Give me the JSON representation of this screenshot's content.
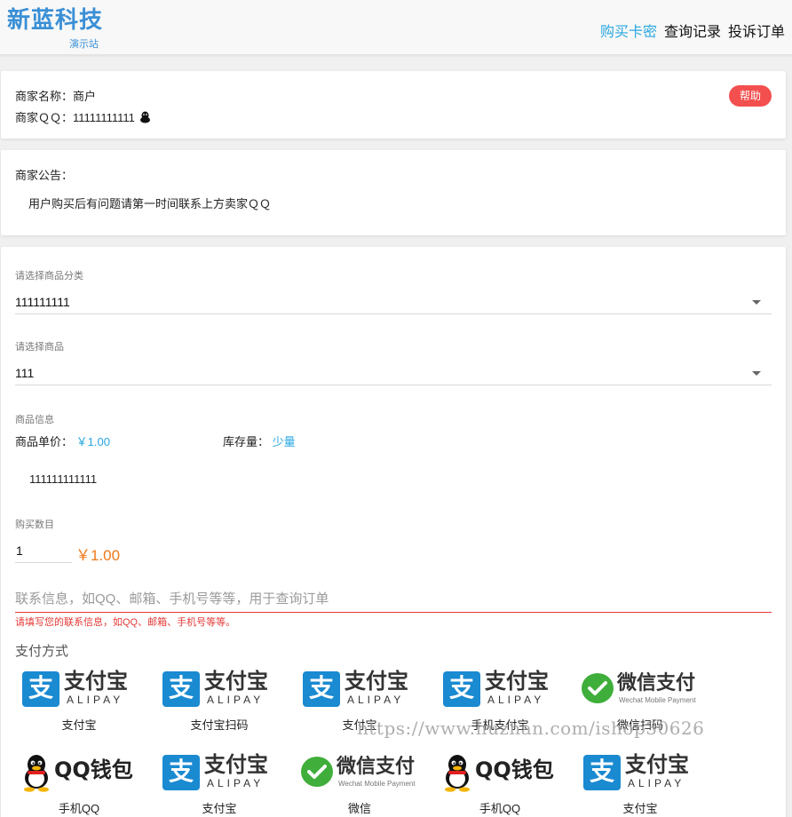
{
  "header": {
    "logo_text": "新蓝科技",
    "logo_sub": "演示站",
    "nav": [
      "购买卡密",
      "查询记录",
      "投诉订单"
    ],
    "accent_color": "#2aa7e0"
  },
  "merchant": {
    "name_label": "商家名称：",
    "name_value": "商户",
    "qq_label": "商家ＱＱ：",
    "qq_value": "11111111111",
    "help_label": "帮助",
    "help_color": "#f44f4f"
  },
  "notice": {
    "title": "商家公告：",
    "body": "用户购买后有问题请第一时间联系上方卖家ＱＱ"
  },
  "form": {
    "category_label": "请选择商品分类",
    "category_value": "111111111",
    "product_label": "请选择商品",
    "product_value": "111",
    "info_label": "商品信息",
    "price_label": "商品单价：",
    "price_value": "￥1.00",
    "stock_label": "库存量：",
    "stock_value": "少量",
    "description": "111111111111",
    "qty_label": "购买数目",
    "qty_value": "1",
    "total": "￥1.00",
    "contact_placeholder": "联系信息，如QQ、邮箱、手机号等等，用于查询订单",
    "contact_error": "请填写您的联系信息，如QQ、邮箱、手机号等等。",
    "pay_title": "支付方式"
  },
  "payments": [
    {
      "brand": "alipay",
      "caption": "支付宝"
    },
    {
      "brand": "alipay",
      "caption": "支付宝扫码"
    },
    {
      "brand": "alipay",
      "caption": "支付宝"
    },
    {
      "brand": "alipay",
      "caption": "手机支付宝"
    },
    {
      "brand": "wechat",
      "caption": "微信扫码"
    },
    {
      "brand": "qq",
      "caption": "手机QQ"
    },
    {
      "brand": "alipay",
      "caption": "支付宝"
    },
    {
      "brand": "wechat",
      "caption": "微信"
    },
    {
      "brand": "qq",
      "caption": "手机QQ"
    },
    {
      "brand": "alipay",
      "caption": "支付宝"
    }
  ],
  "brand_text": {
    "alipay_cn": "支付宝",
    "alipay_en": "ALIPAY",
    "alipay_mark": "支",
    "wechat_cn": "微信支付",
    "wechat_en": "Wechat Mobile Payment",
    "qq_cn": "QQ钱包"
  },
  "watermark": "https://www.huzhan.com/ishop30626"
}
